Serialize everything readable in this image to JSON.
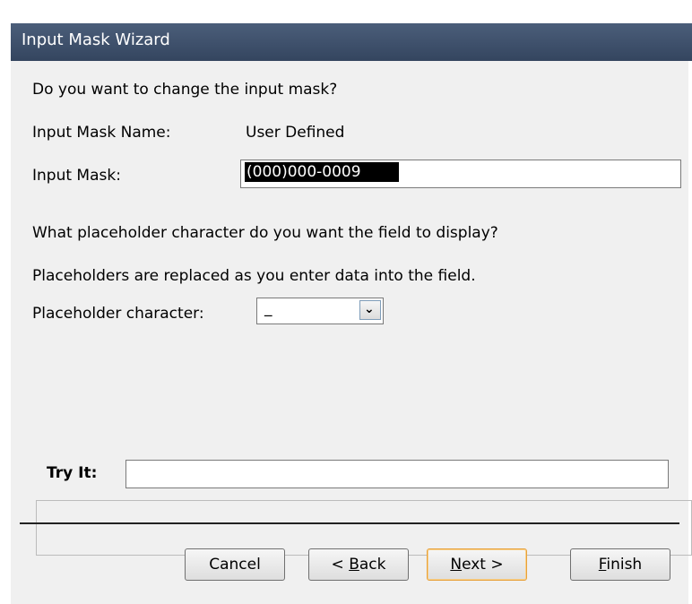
{
  "window": {
    "title": "Input Mask Wizard"
  },
  "prompt": "Do you want to change the input mask?",
  "mask_name": {
    "label": "Input Mask Name:",
    "value": "User Defined"
  },
  "mask": {
    "label": "Input Mask:",
    "value": "(000)000-0009"
  },
  "placeholder_question": "What placeholder character do you want the field to display?",
  "placeholder_hint": "Placeholders are replaced as you enter data into the field.",
  "placeholder": {
    "label": "Placeholder character:",
    "value": "_"
  },
  "tryit": {
    "label": "Try It:",
    "value": ""
  },
  "buttons": {
    "cancel": "Cancel",
    "back_prefix": "< ",
    "back_mnemonic": "B",
    "back_rest": "ack",
    "next_mnemonic": "N",
    "next_rest": "ext >",
    "finish_mnemonic": "F",
    "finish_rest": "inish"
  }
}
